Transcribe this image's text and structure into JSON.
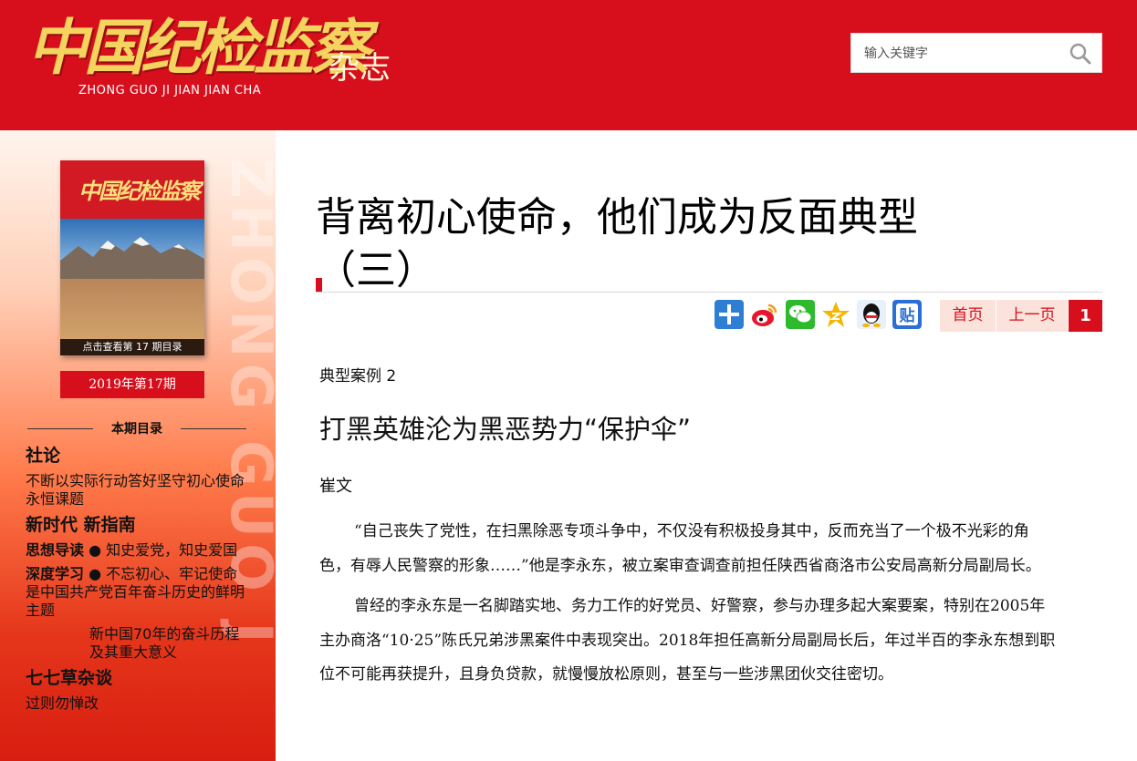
{
  "header": {
    "logo_text": "中国纪检监察",
    "logo_suffix": "杂志",
    "logo_pinyin": "ZHONG GUO JI JIAN JIAN CHA",
    "search_placeholder": "输入关键字",
    "brand_color": "#d70f1c"
  },
  "sidebar": {
    "watermark": "ZHONG GUO J",
    "cover_title": "中国纪检监察",
    "cover_cta": "点击查看第 17 期目录",
    "issue_label": "2019年第17期",
    "toc_heading": "本期目录",
    "sections": [
      {
        "title": "社论",
        "links": [
          {
            "text": "不断以实际行动答好坚守初心使命永恒课题"
          }
        ]
      },
      {
        "title": "新时代 新指南",
        "links": [
          {
            "bold": "思想导读",
            "text": " ● 知史爱党，知史爱国"
          },
          {
            "bold": "深度学习",
            "text": " ● 不忘初心、牢记使命是中国共产党百年奋斗历史的鲜明主题"
          },
          {
            "bold": "",
            "text": "新中国70年的奋斗历程及其重大意义"
          }
        ]
      },
      {
        "title": "七七草杂谈",
        "links": [
          {
            "text": "过则勿惮改"
          }
        ]
      }
    ]
  },
  "article": {
    "title": "背离初心使命，他们成为反面典型（三）",
    "share_icons": [
      "plus-share-icon",
      "weibo-icon",
      "wechat-icon",
      "qzone-icon",
      "qq-icon",
      "tieba-icon"
    ],
    "pager": {
      "home": "首页",
      "prev": "上一页",
      "current": "1"
    },
    "category": "典型案例 2",
    "subtitle": "打黑英雄沦为黑恶势力“保护伞”",
    "author": "崔文",
    "paragraphs": [
      "“自己丧失了党性，在扫黑除恶专项斗争中，不仅没有积极投身其中，反而充当了一个极不光彩的角色，有辱人民警察的形象……”他是李永东，被立案审查调查前担任陕西省商洛市公安局高新分局副局长。",
      "曾经的李永东是一名脚踏实地、务力工作的好党员、好警察，参与办理多起大案要案，特别在2005年主办商洛“10·25”陈氏兄弟涉黑案件中表现突出。2018年担任高新分局副局长后，年过半百的李永东想到职位不可能再获提升，且身负贷款，就慢慢放松原则，甚至与一些涉黑团伙交往密切。"
    ]
  }
}
